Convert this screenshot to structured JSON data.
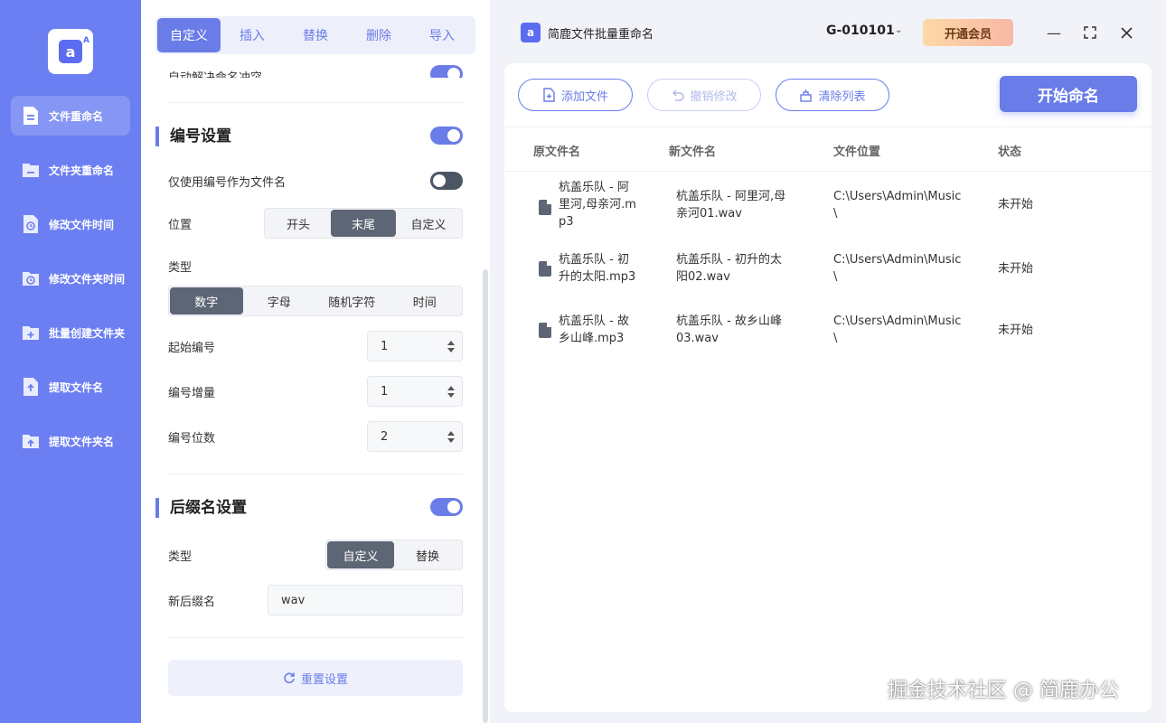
{
  "sidebar": {
    "items": [
      {
        "label": "文件重命名",
        "icon": "file-rename-icon",
        "active": true
      },
      {
        "label": "文件夹重命名",
        "icon": "folder-rename-icon"
      },
      {
        "label": "修改文件时间",
        "icon": "file-clock-icon"
      },
      {
        "label": "修改文件夹时间",
        "icon": "folder-clock-icon"
      },
      {
        "label": "批量创建文件夹",
        "icon": "folder-add-icon"
      },
      {
        "label": "提取文件名",
        "icon": "file-extract-icon"
      },
      {
        "label": "提取文件夹名",
        "icon": "folder-extract-icon"
      }
    ]
  },
  "tabs": [
    "自定义",
    "插入",
    "替换",
    "删除",
    "导入"
  ],
  "partial_row": {
    "label": "自动解决命名冲突",
    "on": true
  },
  "numbering": {
    "title": "编号设置",
    "enabled": true,
    "only_number_label": "仅使用编号作为文件名",
    "only_number_on": false,
    "position_label": "位置",
    "position_options": [
      "开头",
      "末尾",
      "自定义"
    ],
    "position_selected": "末尾",
    "type_label": "类型",
    "type_options": [
      "数字",
      "字母",
      "随机字符",
      "时间"
    ],
    "type_selected": "数字",
    "start_label": "起始编号",
    "start_value": "1",
    "step_label": "编号增量",
    "step_value": "1",
    "digits_label": "编号位数",
    "digits_value": "2"
  },
  "suffix": {
    "title": "后缀名设置",
    "enabled": true,
    "type_label": "类型",
    "type_options": [
      "自定义",
      "替换"
    ],
    "type_selected": "自定义",
    "new_suffix_label": "新后缀名",
    "new_suffix_value": "wav"
  },
  "reset_label": "重置设置",
  "app": {
    "title": "简鹿文件批量重命名",
    "user_id": "G-010101",
    "vip_label": "开通会员"
  },
  "toolbar": {
    "add_file": "添加文件",
    "undo": "撤销修改",
    "clear": "清除列表",
    "start": "开始命名"
  },
  "table": {
    "headers": [
      "原文件名",
      "新文件名",
      "文件位置",
      "状态"
    ],
    "rows": [
      {
        "orig": [
          "杭盖乐队 - 阿",
          "里河,母亲河.m",
          "p3"
        ],
        "new": [
          "杭盖乐队 - 阿里河,母",
          "亲河01.wav"
        ],
        "loc": [
          "C:\\Users\\Admin\\Music",
          "\\"
        ],
        "status": "未开始"
      },
      {
        "orig": [
          "杭盖乐队 - 初",
          "升的太阳.mp3"
        ],
        "new": [
          "杭盖乐队 - 初升的太",
          "阳02.wav"
        ],
        "loc": [
          "C:\\Users\\Admin\\Music",
          "\\"
        ],
        "status": "未开始"
      },
      {
        "orig": [
          "杭盖乐队 - 故",
          "乡山峰.mp3"
        ],
        "new": [
          "杭盖乐队 - 故乡山峰",
          "03.wav"
        ],
        "loc": [
          "C:\\Users\\Admin\\Music",
          "\\"
        ],
        "status": "未开始"
      }
    ]
  },
  "watermark": "掘金技术社区 @ 简鹿办公",
  "colors": {
    "accent": "#6a7ce8",
    "sidebar": "#6c7ff2",
    "segment_active": "#5d6675"
  }
}
